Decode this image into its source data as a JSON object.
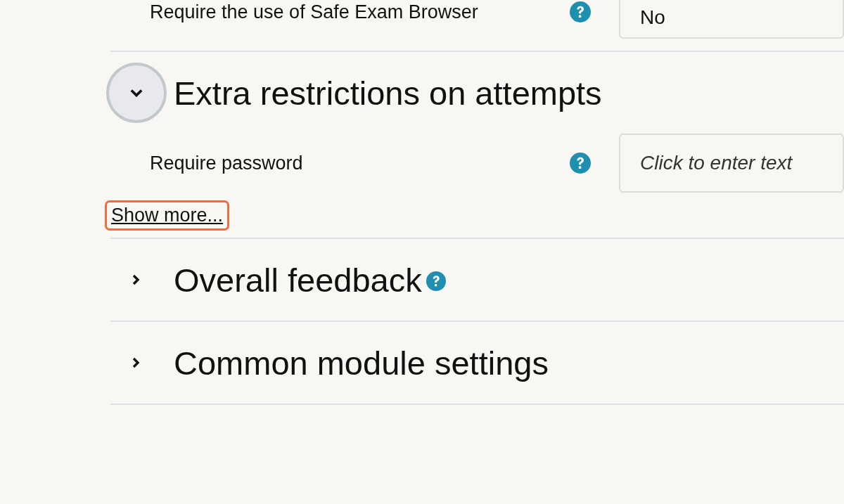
{
  "previous_section_rows": [
    {
      "label": "Require the use of Safe Exam Browser",
      "help": true,
      "value": "No"
    }
  ],
  "sections": [
    {
      "title": "Extra restrictions on attempts",
      "expanded": true,
      "help": false,
      "fields": [
        {
          "label": "Require password",
          "help": true,
          "placeholder": "Click to enter text"
        }
      ],
      "show_more": {
        "label": "Show more...",
        "highlighted": true
      }
    },
    {
      "title": "Overall feedback",
      "expanded": false,
      "help": true
    },
    {
      "title": "Common module settings",
      "expanded": false,
      "help": false
    }
  ]
}
